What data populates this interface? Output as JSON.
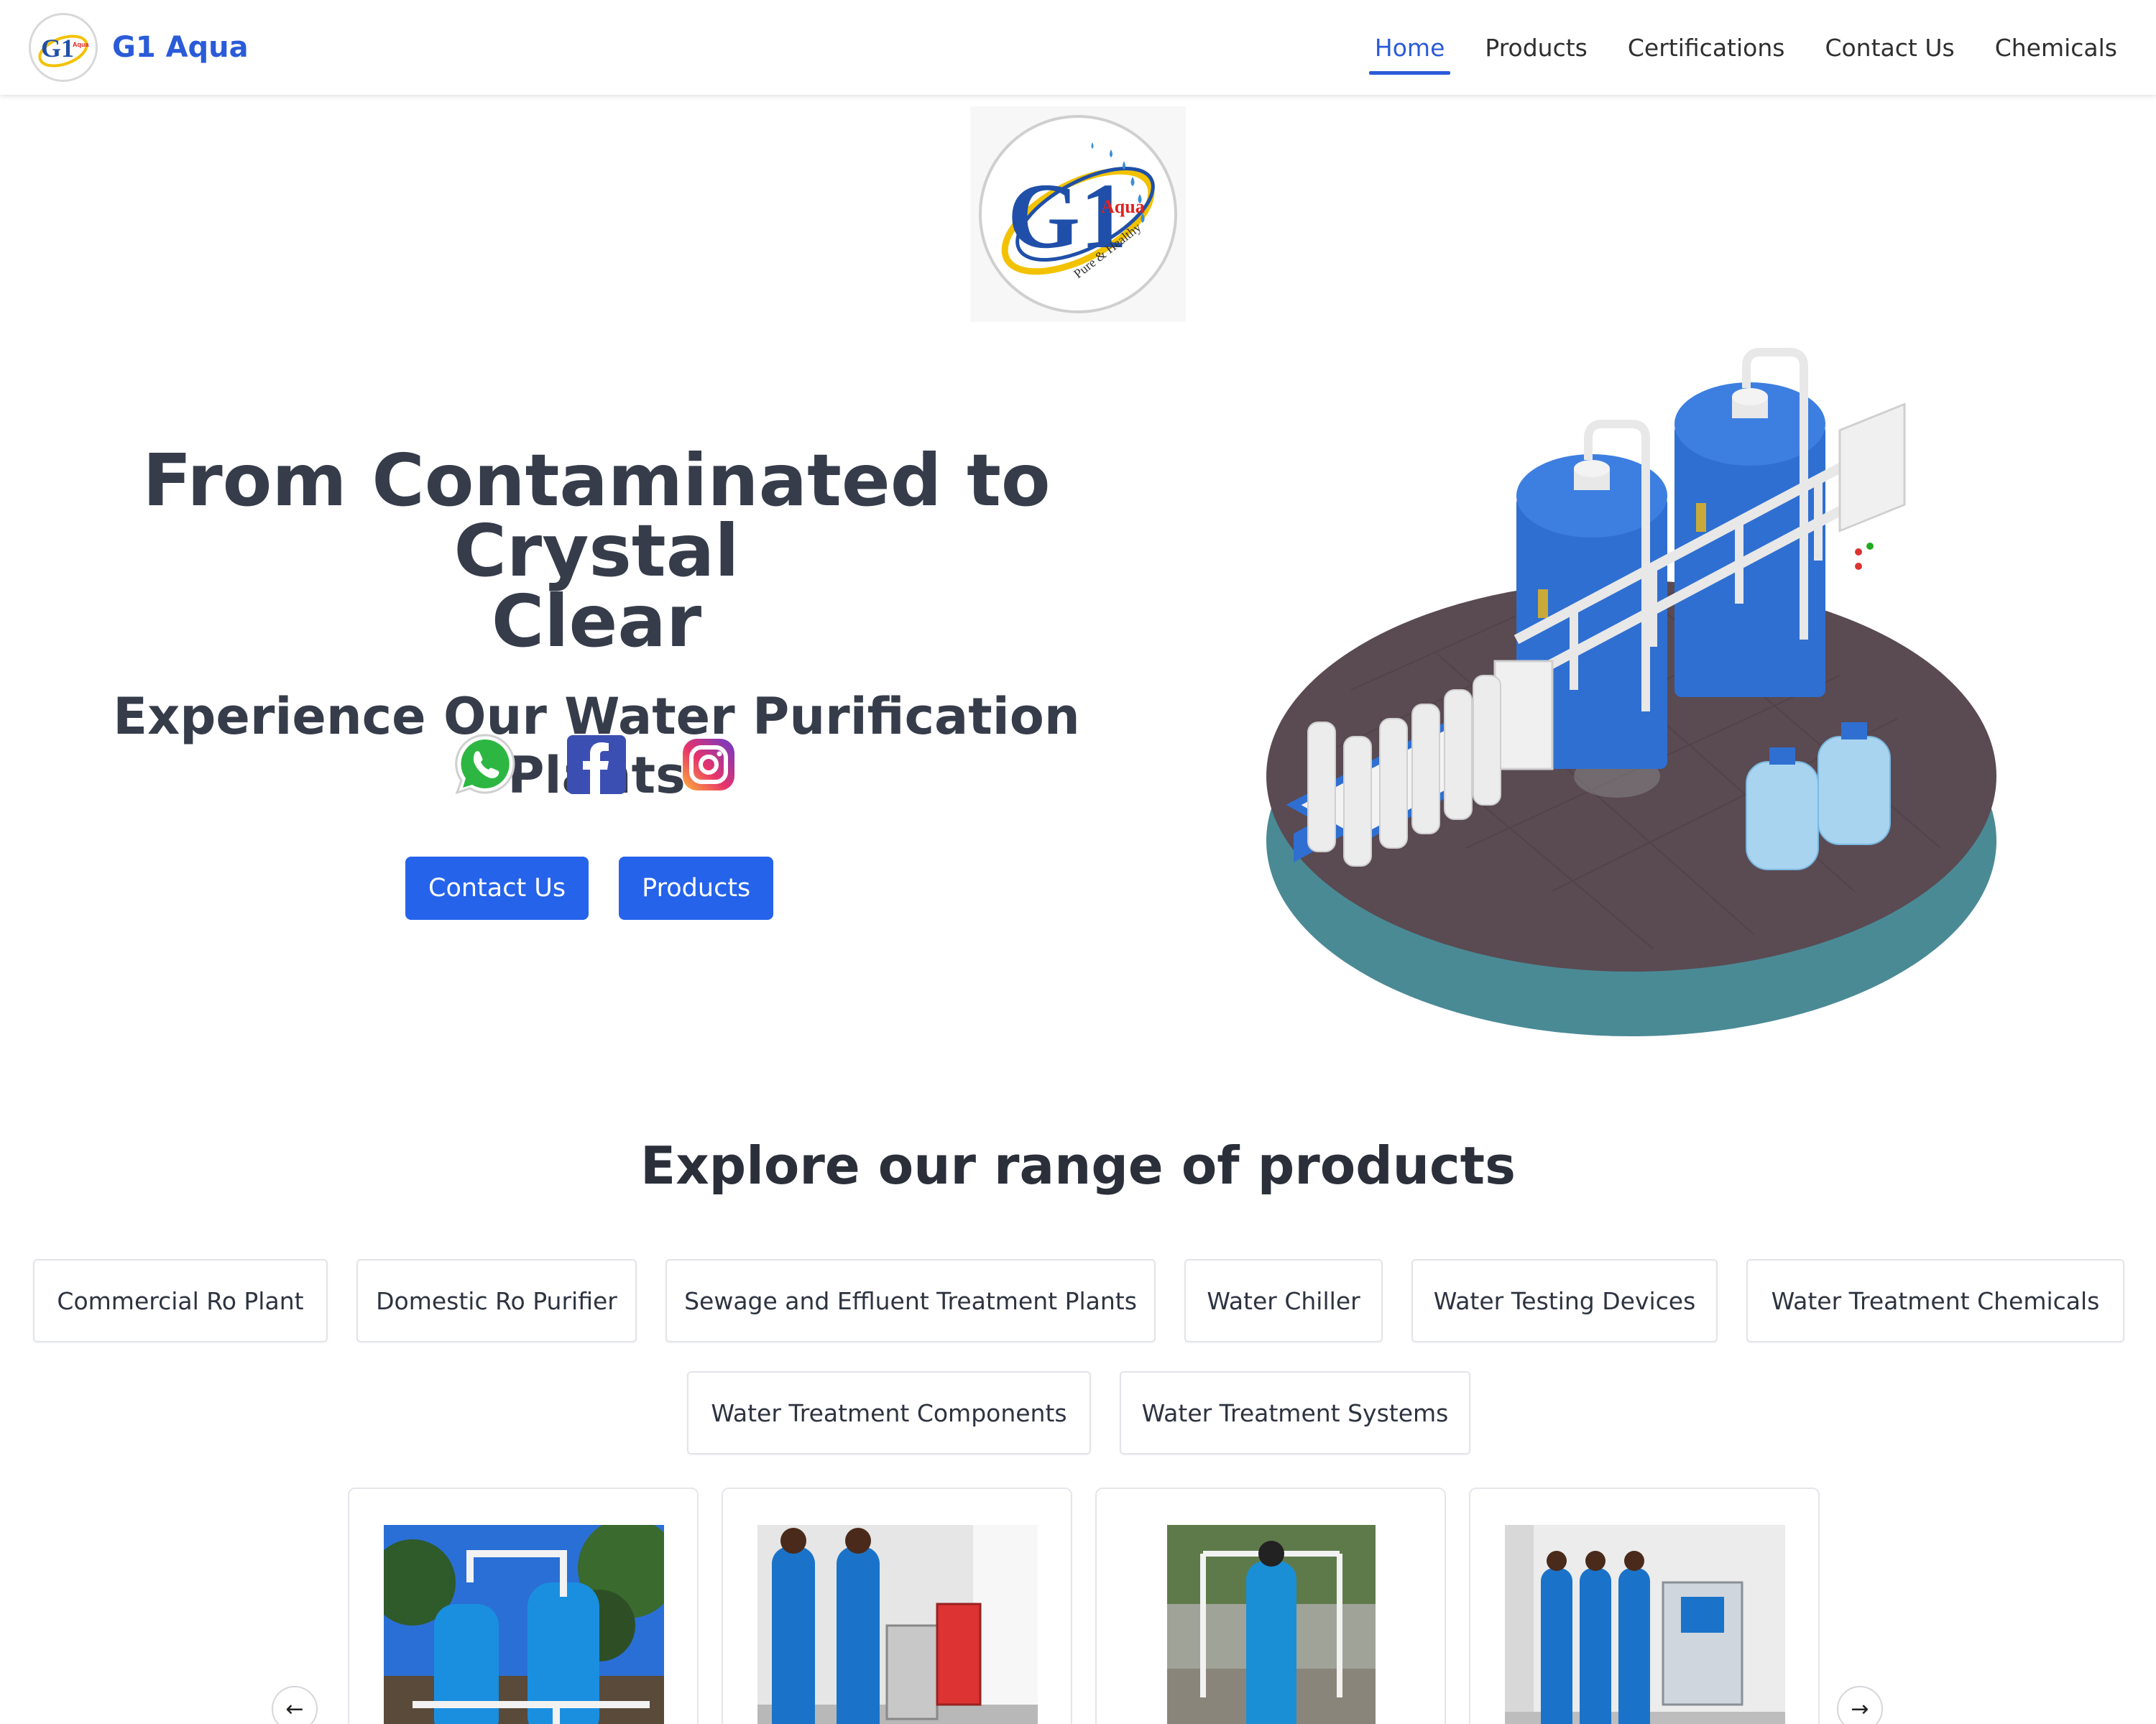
{
  "brand": {
    "name": "G1 Aqua",
    "logo_text": "G1",
    "logo_sub": "Aqua",
    "logo_tagline": "Pure & Healthy"
  },
  "nav": {
    "items": [
      {
        "label": "Home",
        "active": true
      },
      {
        "label": "Products",
        "active": false
      },
      {
        "label": "Certifications",
        "active": false
      },
      {
        "label": "Contact Us",
        "active": false
      },
      {
        "label": "Chemicals",
        "active": false
      }
    ]
  },
  "hero": {
    "title_line1": "From Contaminated to Crystal",
    "title_line2": "Clear",
    "subtitle": "Experience Our Water Purification Plants",
    "socials": [
      "whatsapp-icon",
      "facebook-icon",
      "instagram-icon"
    ],
    "buttons": {
      "contact": "Contact Us",
      "products": "Products"
    }
  },
  "products": {
    "heading": "Explore our range of products",
    "categories": [
      "Commercial Ro Plant",
      "Domestic Ro Purifier",
      "Sewage and Effluent Treatment Plants",
      "Water Chiller",
      "Water Testing Devices",
      "Water Treatment Chemicals",
      "Water Treatment Components",
      "Water Treatment Systems"
    ]
  },
  "carousel": {
    "prev_icon": "arrow-left-icon",
    "next_icon": "arrow-right-icon",
    "prev": "←",
    "next": "→"
  },
  "colors": {
    "accent": "#2563eb",
    "brand": "#2a5bd8",
    "text": "#363c4a",
    "tank_blue": "#2f6fd1",
    "platform": "#5a4a52",
    "platform_edge": "#4a8a95"
  }
}
